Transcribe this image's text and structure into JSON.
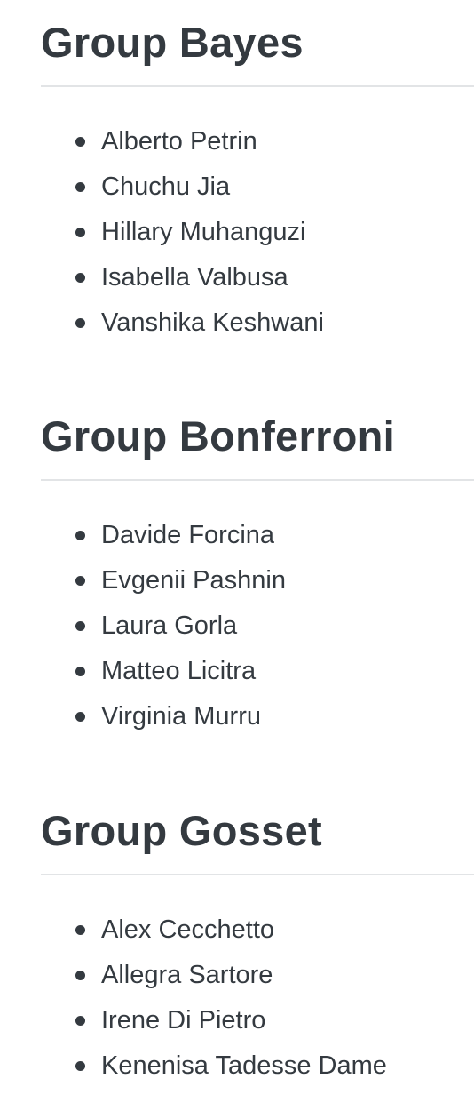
{
  "groups": [
    {
      "title": "Group Bayes",
      "members": [
        "Alberto Petrin",
        "Chuchu Jia",
        "Hillary Muhanguzi",
        "Isabella Valbusa",
        "Vanshika Keshwani"
      ]
    },
    {
      "title": "Group Bonferroni",
      "members": [
        "Davide Forcina",
        "Evgenii Pashnin",
        "Laura Gorla",
        "Matteo Licitra",
        "Virginia Murru"
      ]
    },
    {
      "title": "Group Gosset",
      "members": [
        "Alex Cecchetto",
        "Allegra Sartore",
        "Irene Di Pietro",
        "Kenenisa Tadesse Dame"
      ]
    }
  ]
}
